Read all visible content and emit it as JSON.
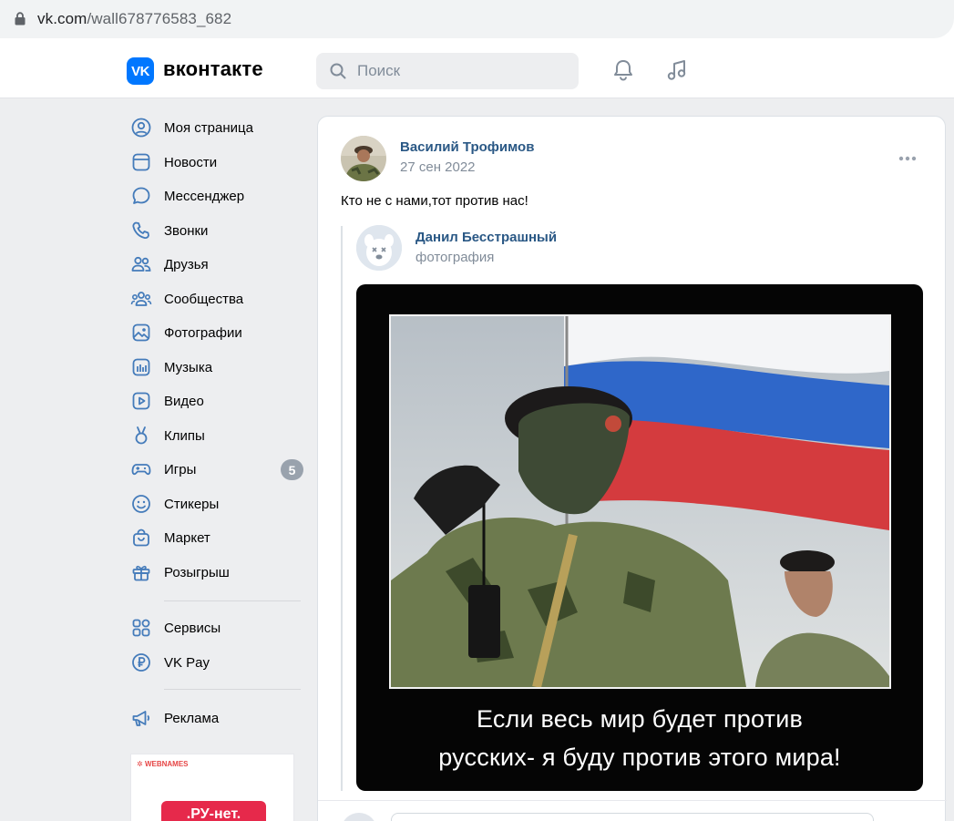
{
  "browser": {
    "url_domain": "vk.com",
    "url_path": "/wall678776583_682"
  },
  "header": {
    "logo_mark": "VK",
    "logo_text": "вконтакте",
    "search_placeholder": "Поиск",
    "icons": [
      "bell-icon",
      "music-note-icon"
    ]
  },
  "nav": {
    "items": [
      {
        "label": "Моя страница",
        "icon": "user-circle-icon"
      },
      {
        "label": "Новости",
        "icon": "newsfeed-icon"
      },
      {
        "label": "Мессенджер",
        "icon": "message-bubble-icon"
      },
      {
        "label": "Звонки",
        "icon": "phone-icon"
      },
      {
        "label": "Друзья",
        "icon": "friends-icon"
      },
      {
        "label": "Сообщества",
        "icon": "communities-icon"
      },
      {
        "label": "Фотографии",
        "icon": "photo-icon"
      },
      {
        "label": "Музыка",
        "icon": "music-icon"
      },
      {
        "label": "Видео",
        "icon": "video-icon"
      },
      {
        "label": "Клипы",
        "icon": "clips-icon"
      },
      {
        "label": "Игры",
        "icon": "gamepad-icon",
        "badge": "5"
      },
      {
        "label": "Стикеры",
        "icon": "smile-icon"
      },
      {
        "label": "Маркет",
        "icon": "bag-icon"
      },
      {
        "label": "Розыгрыш",
        "icon": "gift-icon"
      },
      {
        "label": "Сервисы",
        "icon": "grid-icon"
      },
      {
        "label": "VK Pay",
        "icon": "ruble-icon"
      },
      {
        "label": "Реклама",
        "icon": "megaphone-icon"
      }
    ]
  },
  "ad": {
    "brand": "WEBNAMES",
    "button": ".РУ-нет."
  },
  "post": {
    "author": "Василий Трофимов",
    "date": "27 сен 2022",
    "text": "Кто не с нами,тот против нас!",
    "repost": {
      "author": "Данил Бесстрашный",
      "subtitle": "фотография"
    },
    "photo_caption": {
      "line1": "Если весь мир будет против",
      "line2": "русских- я буду против этого мира!"
    }
  },
  "colors": {
    "accent": "#0077ff",
    "link": "#2a5885",
    "muted": "#818c99",
    "nav_icon": "#447bba",
    "page_bg": "#edeef0"
  }
}
